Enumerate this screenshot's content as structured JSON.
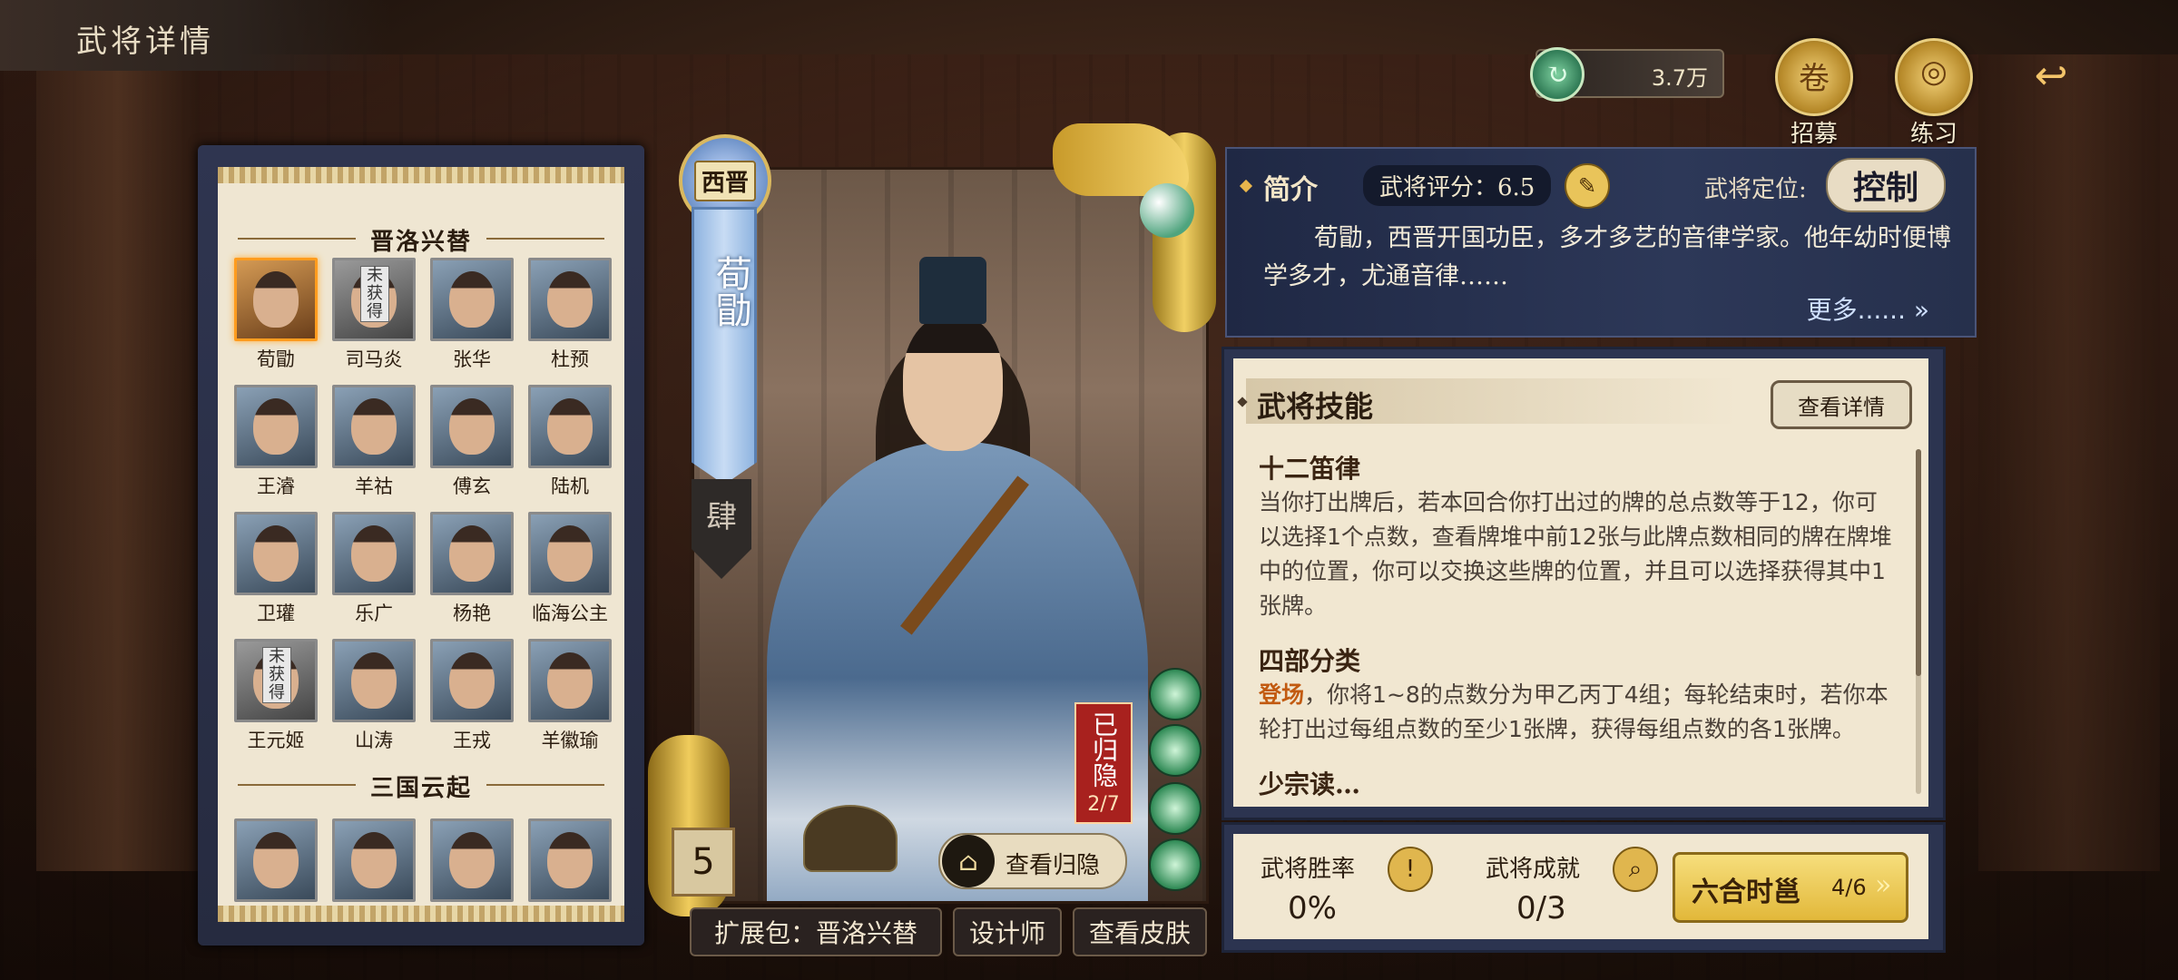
{
  "title": "武将详情",
  "currency": {
    "icon": "jade-coin-icon",
    "value": "3.7万"
  },
  "top_buttons": [
    {
      "label": "招募",
      "icon": "recruit-scroll-icon"
    },
    {
      "label": "练习",
      "icon": "target-icon"
    }
  ],
  "back_icon": "back-arrow-icon",
  "list": {
    "groups": [
      {
        "title": "晋洛兴替",
        "heroes": [
          {
            "name": "荀勖",
            "selected": true,
            "owned": true
          },
          {
            "name": "司马炎",
            "owned": false,
            "unowned_label": "未获得"
          },
          {
            "name": "张华",
            "owned": true
          },
          {
            "name": "杜预",
            "owned": true
          },
          {
            "name": "王濬",
            "owned": true
          },
          {
            "name": "羊祜",
            "owned": true
          },
          {
            "name": "傅玄",
            "owned": true
          },
          {
            "name": "陆机",
            "owned": true
          },
          {
            "name": "卫瓘",
            "owned": true
          },
          {
            "name": "乐广",
            "owned": true
          },
          {
            "name": "杨艳",
            "owned": true
          },
          {
            "name": "临海公主",
            "owned": true
          },
          {
            "name": "王元姬",
            "owned": false,
            "unowned_label": "未获得"
          },
          {
            "name": "山涛",
            "owned": true
          },
          {
            "name": "王戎",
            "owned": true
          },
          {
            "name": "羊徽瑜",
            "owned": true
          }
        ]
      },
      {
        "title": "三国云起",
        "heroes": [
          {
            "name": "",
            "owned": true
          },
          {
            "name": "",
            "owned": true
          },
          {
            "name": "",
            "owned": true
          },
          {
            "name": "",
            "owned": true
          }
        ]
      }
    ]
  },
  "card": {
    "faction": "西晋",
    "name": "荀勖",
    "rank": "肆",
    "cost": "5",
    "retired_label": "已归隐",
    "retired_count": "2/7",
    "view_retire_label": "查看归隐"
  },
  "bottom_buttons": {
    "expansion": "扩展包：晋洛兴替",
    "designer": "设计师",
    "skins": "查看皮肤"
  },
  "intro": {
    "label": "简介",
    "score": "武将评分：6.5",
    "position_label": "武将定位:",
    "position": "控制",
    "description": "荀勖，西晋开国功臣，多才多艺的音律学家。他年幼时便博学多才，尤通音律……",
    "more": "更多...... »"
  },
  "skills": {
    "header": "武将技能",
    "detail_button": "查看详情",
    "list": [
      {
        "name": "十二笛律",
        "keyword": "",
        "desc": "当你打出牌后，若本回合你打出过的牌的总点数等于12，你可以选择1个点数，查看牌堆中前12张与此牌点数相同的牌在牌堆中的位置，你可以交换这些牌的位置，并且可以选择获得其中1张牌。"
      },
      {
        "name": "四部分类",
        "keyword": "登场",
        "desc": "，你将1~8的点数分为甲乙丙丁4组；每轮结束时，若你本轮打出过每组点数的至少1张牌，获得每组点数的各1张牌。"
      },
      {
        "name": "少宗读…",
        "keyword": "",
        "desc": ""
      }
    ]
  },
  "stats": {
    "win_rate_label": "武将胜率",
    "win_rate": "0%",
    "achieve_label": "武将成就",
    "achieve": "0/3",
    "sixhe_label": "六合时邕",
    "sixhe_count": "4/6"
  }
}
